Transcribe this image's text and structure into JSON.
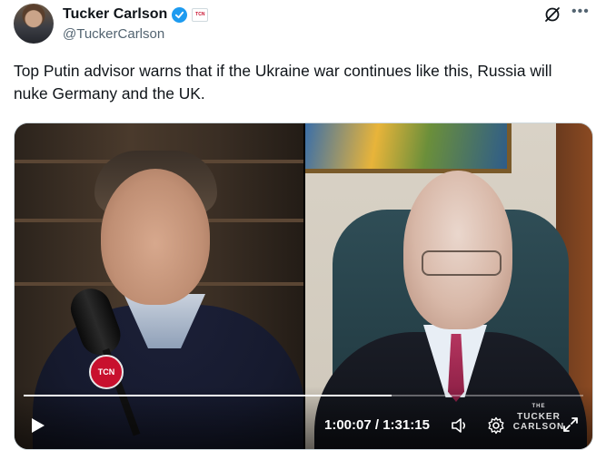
{
  "author": {
    "name": "Tucker Carlson",
    "handle": "@TuckerCarlson",
    "verified": true,
    "affiliate_badge_text": "TCN"
  },
  "tweet": {
    "text": "Top Putin advisor warns that if the Ukraine war continues like this, Russia will nuke Germany and the UK."
  },
  "video": {
    "elapsed": "1:00:07",
    "duration": "1:31:15",
    "time_separator": " / ",
    "progress": 0.658,
    "mic_flag_text": "TCN",
    "watermark_line1": "THE",
    "watermark_line2": "TUCKER",
    "watermark_line3": "CARLSON"
  },
  "icons": [
    "verified-icon",
    "grok-icon",
    "more-icon",
    "play-icon",
    "volume-icon",
    "settings-icon",
    "fullscreen-icon"
  ],
  "colors": {
    "accent": "#1d9bf0",
    "secondary_text": "#536471",
    "badge_red": "#c8102e"
  }
}
